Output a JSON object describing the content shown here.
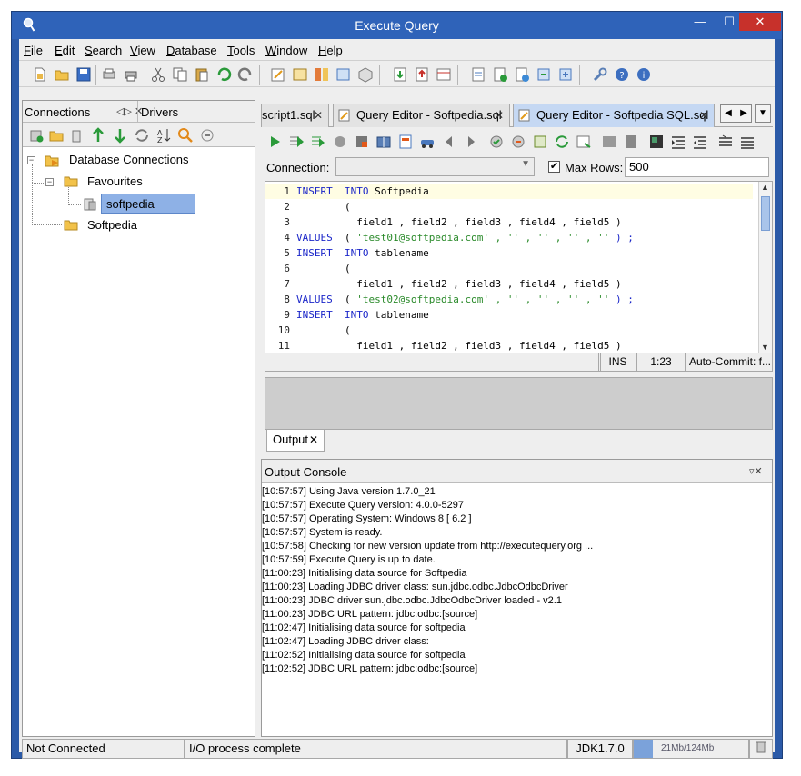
{
  "window": {
    "title": "Execute Query",
    "minimize": "—",
    "maximize": "☐",
    "close": "✕"
  },
  "menu": [
    "File",
    "Edit",
    "Search",
    "View",
    "Database",
    "Tools",
    "Window",
    "Help"
  ],
  "left_panel": {
    "tabs": {
      "connections": "Connections",
      "drivers": "Drivers",
      "controls": "◁▷ ✕"
    },
    "tree": {
      "root": "Database Connections",
      "favourites": "Favourites",
      "favourite_child": "softpedia",
      "other": "Softpedia"
    }
  },
  "editor": {
    "tabs": [
      {
        "label": "script1.sql"
      },
      {
        "label": "Query Editor - Softpedia.sql"
      },
      {
        "label": "Query Editor - Softpedia SQL.sql"
      }
    ],
    "tab_close": "✕",
    "connection_label": "Connection:",
    "connection_value": "",
    "max_rows_label": "Max Rows:",
    "max_rows_checked": "✔",
    "max_rows_value": "500",
    "lines": [
      {
        "n": "1",
        "kw": "INSERT  INTO",
        "rest": " Softpedia",
        "str": "",
        "tail": ""
      },
      {
        "n": "2",
        "kw": "",
        "rest": "        (",
        "str": "",
        "tail": ""
      },
      {
        "n": "3",
        "kw": "",
        "rest": "          field1 , field2 , field3 , field4 , field5 )",
        "str": "",
        "tail": ""
      },
      {
        "n": "4",
        "kw": "VALUES",
        "rest": "  ( ",
        "str": "'test01@softpedia.com' , '' , '' , '' , ''",
        "tail": " ) ;"
      },
      {
        "n": "5",
        "kw": "INSERT  INTO",
        "rest": " tablename",
        "str": "",
        "tail": ""
      },
      {
        "n": "6",
        "kw": "",
        "rest": "        (",
        "str": "",
        "tail": ""
      },
      {
        "n": "7",
        "kw": "",
        "rest": "          field1 , field2 , field3 , field4 , field5 )",
        "str": "",
        "tail": ""
      },
      {
        "n": "8",
        "kw": "VALUES",
        "rest": "  ( ",
        "str": "'test02@softpedia.com' , '' , '' , '' , ''",
        "tail": " ) ;"
      },
      {
        "n": "9",
        "kw": "INSERT  INTO",
        "rest": " tablename",
        "str": "",
        "tail": ""
      },
      {
        "n": "10",
        "kw": "",
        "rest": "        (",
        "str": "",
        "tail": ""
      },
      {
        "n": "11",
        "kw": "",
        "rest": "          field1 , field2 , field3 , field4 , field5 )",
        "str": "",
        "tail": ""
      }
    ],
    "status": {
      "mode": "INS",
      "position": "1:23",
      "autocommit": "Auto-Commit: f..."
    },
    "output_tab": "Output"
  },
  "console": {
    "title": "Output Console",
    "controls": "▿✕",
    "lines": [
      "[10:57:57] Using Java version 1.7.0_21",
      "[10:57:57] Execute Query version: 4.0.0-5297",
      "[10:57:57] Operating System: Windows 8 [ 6.2 ]",
      "[10:57:57] System is ready.",
      "[10:57:58] Checking for new version update from http://executequery.org ...",
      "[10:57:59] Execute Query is up to date.",
      "[11:00:23] Initialising data source for Softpedia",
      "[11:00:23] Loading JDBC driver class: sun.jdbc.odbc.JdbcOdbcDriver",
      "[11:00:23] JDBC driver sun.jdbc.odbc.JdbcOdbcDriver loaded - v2.1",
      "[11:00:23] JDBC URL pattern: jdbc:odbc:[source]",
      "[11:02:47] Initialising data source for softpedia",
      "[11:02:47] Loading JDBC driver class:",
      "[11:02:52] Initialising data source for softpedia",
      "[11:02:52] JDBC URL pattern: jdbc:odbc:[source]"
    ]
  },
  "statusbar": {
    "connection": "Not Connected",
    "io": "I/O process complete",
    "jdk": "JDK1.7.0",
    "memory": "21Mb/124Mb",
    "memory_used_fraction": 0.17
  },
  "colors": {
    "title_bar": "#2f63b9",
    "keyword": "#1c27c9",
    "string": "#2a8a2a",
    "selection": "#8eb1e6",
    "active_tab": "#c5d8f3"
  }
}
